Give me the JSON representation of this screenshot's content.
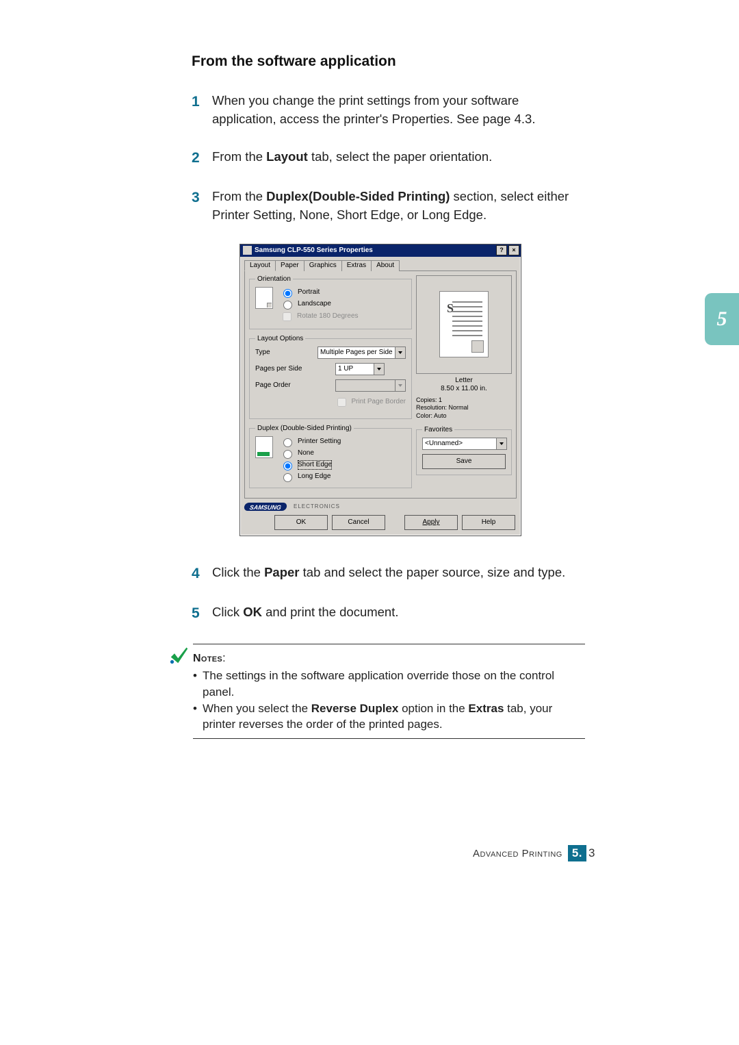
{
  "title": "From the software application",
  "steps": {
    "s1": {
      "num": "1",
      "text": "When you change the print settings from your software application, access the printer's Properties. See page 4.3."
    },
    "s2": {
      "num": "2",
      "text_prefix": "From the ",
      "bold": "Layout",
      "text_suffix": " tab, select the paper orientation."
    },
    "s3": {
      "num": "3",
      "text_prefix": "From the ",
      "bold": "Duplex(Double-Sided Printing)",
      "text_suffix": " section, select either Printer Setting, None, Short Edge, or Long Edge."
    },
    "s4": {
      "num": "4",
      "text_prefix": "Click the ",
      "bold": "Paper",
      "text_suffix": " tab and select the paper source, size and type."
    },
    "s5": {
      "num": "5",
      "text_prefix": "Click ",
      "bold": "OK",
      "text_suffix": " and print the document."
    }
  },
  "dialog": {
    "title": "Samsung CLP-550 Series Properties",
    "winbtn_help": "?",
    "winbtn_close": "×",
    "tabs": {
      "layout": "Layout",
      "paper": "Paper",
      "graphics": "Graphics",
      "extras": "Extras",
      "about": "About"
    },
    "orientation": {
      "legend": "Orientation",
      "portrait": "Portrait",
      "landscape": "Landscape",
      "rotate": "Rotate 180 Degrees"
    },
    "layout_options": {
      "legend": "Layout Options",
      "type_label": "Type",
      "type_value": "Multiple Pages per Side",
      "pps_label": "Pages per Side",
      "pps_value": "1 UP",
      "order_label": "Page Order",
      "order_value": "",
      "print_border": "Print Page Border"
    },
    "duplex": {
      "legend": "Duplex (Double-Sided Printing)",
      "printer_setting": "Printer Setting",
      "none": "None",
      "short_edge": "Short Edge",
      "long_edge": "Long Edge"
    },
    "preview": {
      "s": "S",
      "caption_line1": "Letter",
      "caption_line2": "8.50 x 11.00 in.",
      "copies": "Copies: 1",
      "resolution": "Resolution: Normal",
      "color": "Color: Auto"
    },
    "favorites": {
      "legend": "Favorites",
      "value": "<Unnamed>",
      "save": "Save"
    },
    "brand": {
      "name": "SAMSUNG",
      "sub": "ELECTRONICS"
    },
    "buttons": {
      "ok": "OK",
      "cancel": "Cancel",
      "apply": "Apply",
      "help": "Help"
    }
  },
  "chapter_tab": "5",
  "notes": {
    "heading": "Notes",
    "colon": ":",
    "n1": "The settings in the software application override those on the control panel.",
    "n2_a": "When you select the ",
    "n2_b": "Reverse Duplex",
    "n2_c": " option in the ",
    "n2_d": "Extras",
    "n2_e": " tab, your printer reverses the order of the printed pages."
  },
  "footer": {
    "label": "Advanced Printing",
    "chapter": "5.",
    "page": "3"
  }
}
